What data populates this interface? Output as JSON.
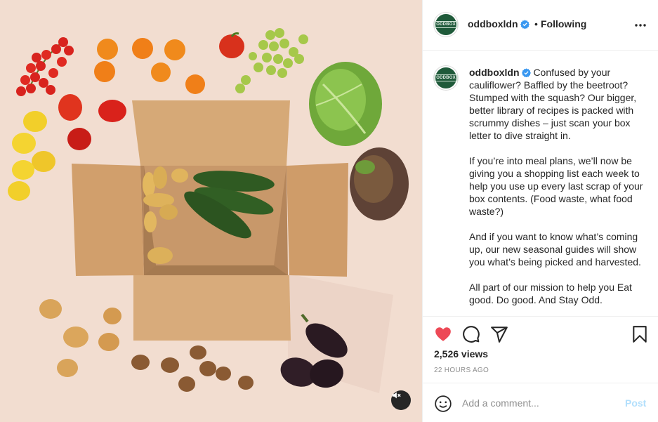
{
  "post": {
    "username": "oddboxldn",
    "follow_state": "Following",
    "separator": "•",
    "avatar_text": "ODDBOX",
    "caption_paragraphs": [
      "Confused by your cauliflower? Baffled by the beetroot? Stumped with the squash? Our bigger, better library of recipes is packed with scrummy dishes – just scan your box letter to dive straight in.",
      "If you’re into meal plans, we’ll now be giving you a shopping list each week to help you use up every last scrap of your box contents. (Food waste, what food waste?)",
      "And if you want to know what’s coming up, our new seasonal guides will show you what’s being picked and harvested.",
      "All part of our mission to help you Eat good. Do good. And Stay Odd."
    ],
    "views": "2,526 views",
    "timestamp": "22 HOURS AGO",
    "liked": true
  },
  "comment": {
    "placeholder": "Add a comment...",
    "post_label": "Post"
  },
  "icons": {
    "more": "more-options-icon",
    "verified": "verified-badge-icon",
    "like": "heart-icon",
    "comment": "comment-icon",
    "share": "share-icon",
    "save": "bookmark-icon",
    "emoji": "emoji-icon",
    "mute": "mute-icon"
  },
  "colors": {
    "like_red": "#ed4956",
    "verified_blue": "#3897f0",
    "post_disabled": "#b2dffc",
    "media_background": "#f2ddd0",
    "avatar_green": "#1f5a3a"
  }
}
